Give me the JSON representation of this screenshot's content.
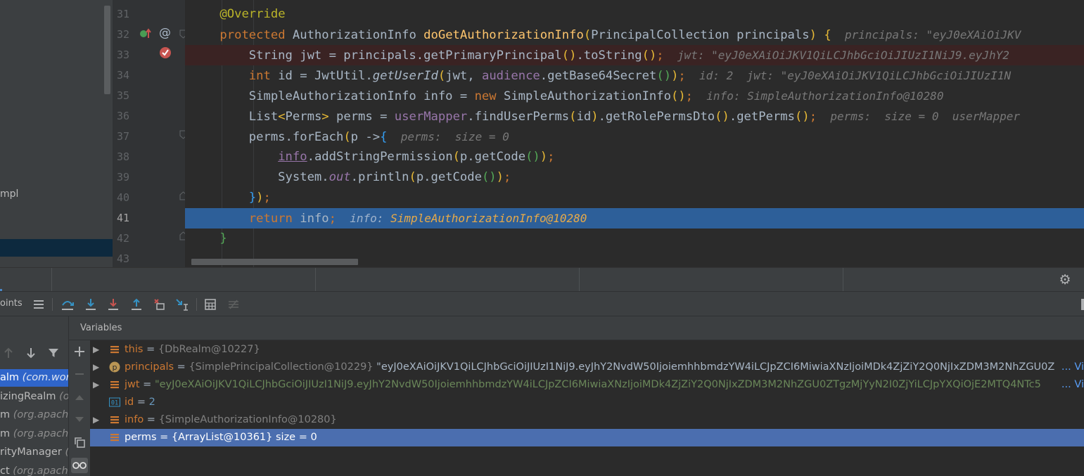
{
  "project_panel": {
    "item_fragment": "mpl"
  },
  "editor": {
    "lines": [
      {
        "number": "31",
        "parts": [
          {
            "t": "    ",
            "c": ""
          },
          {
            "t": "@Override",
            "c": "t-ann"
          }
        ]
      },
      {
        "number": "32",
        "parts": [
          {
            "t": "    ",
            "c": ""
          },
          {
            "t": "protected ",
            "c": "t-kw"
          },
          {
            "t": "AuthorizationInfo ",
            "c": ""
          },
          {
            "t": "doGetAuthorizationInfo",
            "c": "t-fn"
          },
          {
            "t": "(",
            "c": "t-paren1"
          },
          {
            "t": "PrincipalCollection principals",
            "c": ""
          },
          {
            "t": ") ",
            "c": "t-paren1"
          },
          {
            "t": "{",
            "c": "t-paren1"
          },
          {
            "t": "  principals: \"eyJ0eXAiOiJKV",
            "c": "t-hint"
          }
        ]
      },
      {
        "number": "33",
        "type": "breakpoint",
        "parts": [
          {
            "t": "        String jwt = principals.getPrimaryPrincipal",
            "c": ""
          },
          {
            "t": "()",
            "c": "t-paren1"
          },
          {
            "t": ".toString",
            "c": ""
          },
          {
            "t": "()",
            "c": "t-paren1"
          },
          {
            "t": ";",
            "c": "t-kw"
          },
          {
            "t": "  jwt: \"eyJ0eXAiOiJKV1QiLCJhbGciOiJIUzI1NiJ9.eyJhY2",
            "c": "t-hint"
          }
        ]
      },
      {
        "number": "34",
        "parts": [
          {
            "t": "        ",
            "c": ""
          },
          {
            "t": "int ",
            "c": "t-kw"
          },
          {
            "t": "id = JwtUtil.",
            "c": ""
          },
          {
            "t": "getUserId",
            "c": "t-it"
          },
          {
            "t": "(",
            "c": "t-paren1"
          },
          {
            "t": "jwt, ",
            "c": ""
          },
          {
            "t": "audience",
            "c": "t-field"
          },
          {
            "t": ".getBase64Secret",
            "c": ""
          },
          {
            "t": "()",
            "c": "t-paren2"
          },
          {
            "t": ")",
            "c": "t-paren1"
          },
          {
            "t": ";",
            "c": "t-kw"
          },
          {
            "t": "  id: 2  jwt: \"eyJ0eXAiOiJKV1QiLCJhbGciOiJIUzI1N",
            "c": "t-hint"
          }
        ]
      },
      {
        "number": "35",
        "parts": [
          {
            "t": "        SimpleAuthorizationInfo info = ",
            "c": ""
          },
          {
            "t": "new ",
            "c": "t-kw"
          },
          {
            "t": "SimpleAuthorizationInfo",
            "c": ""
          },
          {
            "t": "()",
            "c": "t-paren1"
          },
          {
            "t": ";",
            "c": "t-kw"
          },
          {
            "t": "  info: SimpleAuthorizationInfo@10280",
            "c": "t-hint"
          }
        ]
      },
      {
        "number": "36",
        "parts": [
          {
            "t": "        List",
            "c": ""
          },
          {
            "t": "<",
            "c": "t-paren1"
          },
          {
            "t": "Perms",
            "c": ""
          },
          {
            "t": ">",
            "c": "t-paren1"
          },
          {
            "t": " perms = ",
            "c": ""
          },
          {
            "t": "userMapper",
            "c": "t-field"
          },
          {
            "t": ".findUserPerms",
            "c": ""
          },
          {
            "t": "(",
            "c": "t-paren1"
          },
          {
            "t": "id",
            "c": ""
          },
          {
            "t": ")",
            "c": "t-paren1"
          },
          {
            "t": ".getRolePermsDto",
            "c": ""
          },
          {
            "t": "()",
            "c": "t-paren1"
          },
          {
            "t": ".getPerms",
            "c": ""
          },
          {
            "t": "()",
            "c": "t-paren1"
          },
          {
            "t": ";",
            "c": "t-kw"
          },
          {
            "t": "  perms:  size = 0  userMapper",
            "c": "t-hint"
          }
        ]
      },
      {
        "number": "37",
        "parts": [
          {
            "t": "        perms.forEach",
            "c": ""
          },
          {
            "t": "(",
            "c": "t-paren1"
          },
          {
            "t": "p ->",
            "c": ""
          },
          {
            "t": "{",
            "c": "t-paren3"
          },
          {
            "t": "  perms:  size = 0",
            "c": "t-hint"
          }
        ]
      },
      {
        "number": "38",
        "parts": [
          {
            "t": "            ",
            "c": ""
          },
          {
            "t": "info",
            "c": "t-field t-under"
          },
          {
            "t": ".addStringPermission",
            "c": ""
          },
          {
            "t": "(",
            "c": "t-paren1"
          },
          {
            "t": "p.getCode",
            "c": ""
          },
          {
            "t": "()",
            "c": "t-paren2"
          },
          {
            "t": ")",
            "c": "t-paren1"
          },
          {
            "t": ";",
            "c": "t-kw"
          }
        ]
      },
      {
        "number": "39",
        "parts": [
          {
            "t": "            System.",
            "c": ""
          },
          {
            "t": "out",
            "c": "t-field-it"
          },
          {
            "t": ".println",
            "c": ""
          },
          {
            "t": "(",
            "c": "t-paren1"
          },
          {
            "t": "p.getCode",
            "c": ""
          },
          {
            "t": "()",
            "c": "t-paren2"
          },
          {
            "t": ")",
            "c": "t-paren1"
          },
          {
            "t": ";",
            "c": "t-kw"
          }
        ]
      },
      {
        "number": "40",
        "parts": [
          {
            "t": "        ",
            "c": ""
          },
          {
            "t": "}",
            "c": "t-paren3"
          },
          {
            "t": ")",
            "c": "t-paren1"
          },
          {
            "t": ";",
            "c": "t-kw"
          }
        ]
      },
      {
        "number": "41",
        "type": "exec",
        "parts": [
          {
            "t": "        ",
            "c": ""
          },
          {
            "t": "return ",
            "c": "t-kw"
          },
          {
            "t": "info",
            "c": ""
          },
          {
            "t": ";",
            "c": "t-kw"
          },
          {
            "t": "  info: ",
            "c": "t-hint-exec"
          },
          {
            "t": "SimpleAuthorizationInfo@10280",
            "c": "t-hint-obj"
          }
        ]
      },
      {
        "number": "42",
        "parts": [
          {
            "t": "    ",
            "c": ""
          },
          {
            "t": "}",
            "c": "t-paren2"
          }
        ]
      },
      {
        "number": "43",
        "parts": []
      }
    ]
  },
  "debugger": {
    "tab_fragment": "oints",
    "variables_title": "Variables",
    "frames": [
      {
        "name": "alm ",
        "pkg": "(com.wor",
        "selected": true
      },
      {
        "name": "izingRealm ",
        "pkg": "(o",
        "selected": false
      },
      {
        "name": "m ",
        "pkg": "(org.apache",
        "selected": false
      },
      {
        "name": "m ",
        "pkg": "(org.apache",
        "selected": false
      },
      {
        "name": "rityManager ",
        "pkg": "(",
        "selected": false
      },
      {
        "name": "ct ",
        "pkg": "(org.apach",
        "selected": false
      }
    ],
    "variables": [
      {
        "expandable": true,
        "icon": "field-icon",
        "name": "this",
        "type": "{DbRealm@10227}",
        "value": "",
        "view": ""
      },
      {
        "expandable": true,
        "icon": "parameter-icon",
        "name": "principals",
        "type": "{SimplePrincipalCollection@10229}",
        "value": " \"eyJ0eXAiOiJKV1QiLCJhbGciOiJIUzI1NiJ9.eyJhY2NvdW50IjoiemhhbmdzYW4iLCJpZCI6MiwiaXNzIjoiMDk4ZjZiY2Q0NjIxZDM3M2NhZGU0Z",
        "view": "... Vi"
      },
      {
        "expandable": true,
        "icon": "field-icon",
        "name": "jwt",
        "type": "",
        "value": "\"eyJ0eXAiOiJKV1QiLCJhbGciOiJIUzI1NiJ9.eyJhY2NvdW50IjoiemhhbmdzYW4iLCJpZCI6MiwiaXNzIjoiMDk4ZjZiY2Q0NjIxZDM3M2NhZGU0ZTgzMjYyN2I0ZjYiLCJpYXQiOjE2MTQ4NTc5",
        "view": "... Vi"
      },
      {
        "expandable": false,
        "icon": "primitive-icon",
        "name": "id",
        "type": "",
        "value": "2",
        "view": ""
      },
      {
        "expandable": true,
        "icon": "field-icon",
        "name": "info",
        "type": "{SimpleAuthorizationInfo@10280}",
        "value": "",
        "view": ""
      },
      {
        "expandable": false,
        "icon": "field-icon",
        "name": "perms",
        "type": "{ArrayList@10361}",
        "value": "  size = 0",
        "view": "",
        "selected": true
      }
    ]
  },
  "colors": {
    "breakpoint_red": "#c75450",
    "exec_line_blue": "#2d5f99",
    "selection_blue": "#4b6eaf",
    "string_green": "#6a8759",
    "keyword_orange": "#cc7832"
  }
}
